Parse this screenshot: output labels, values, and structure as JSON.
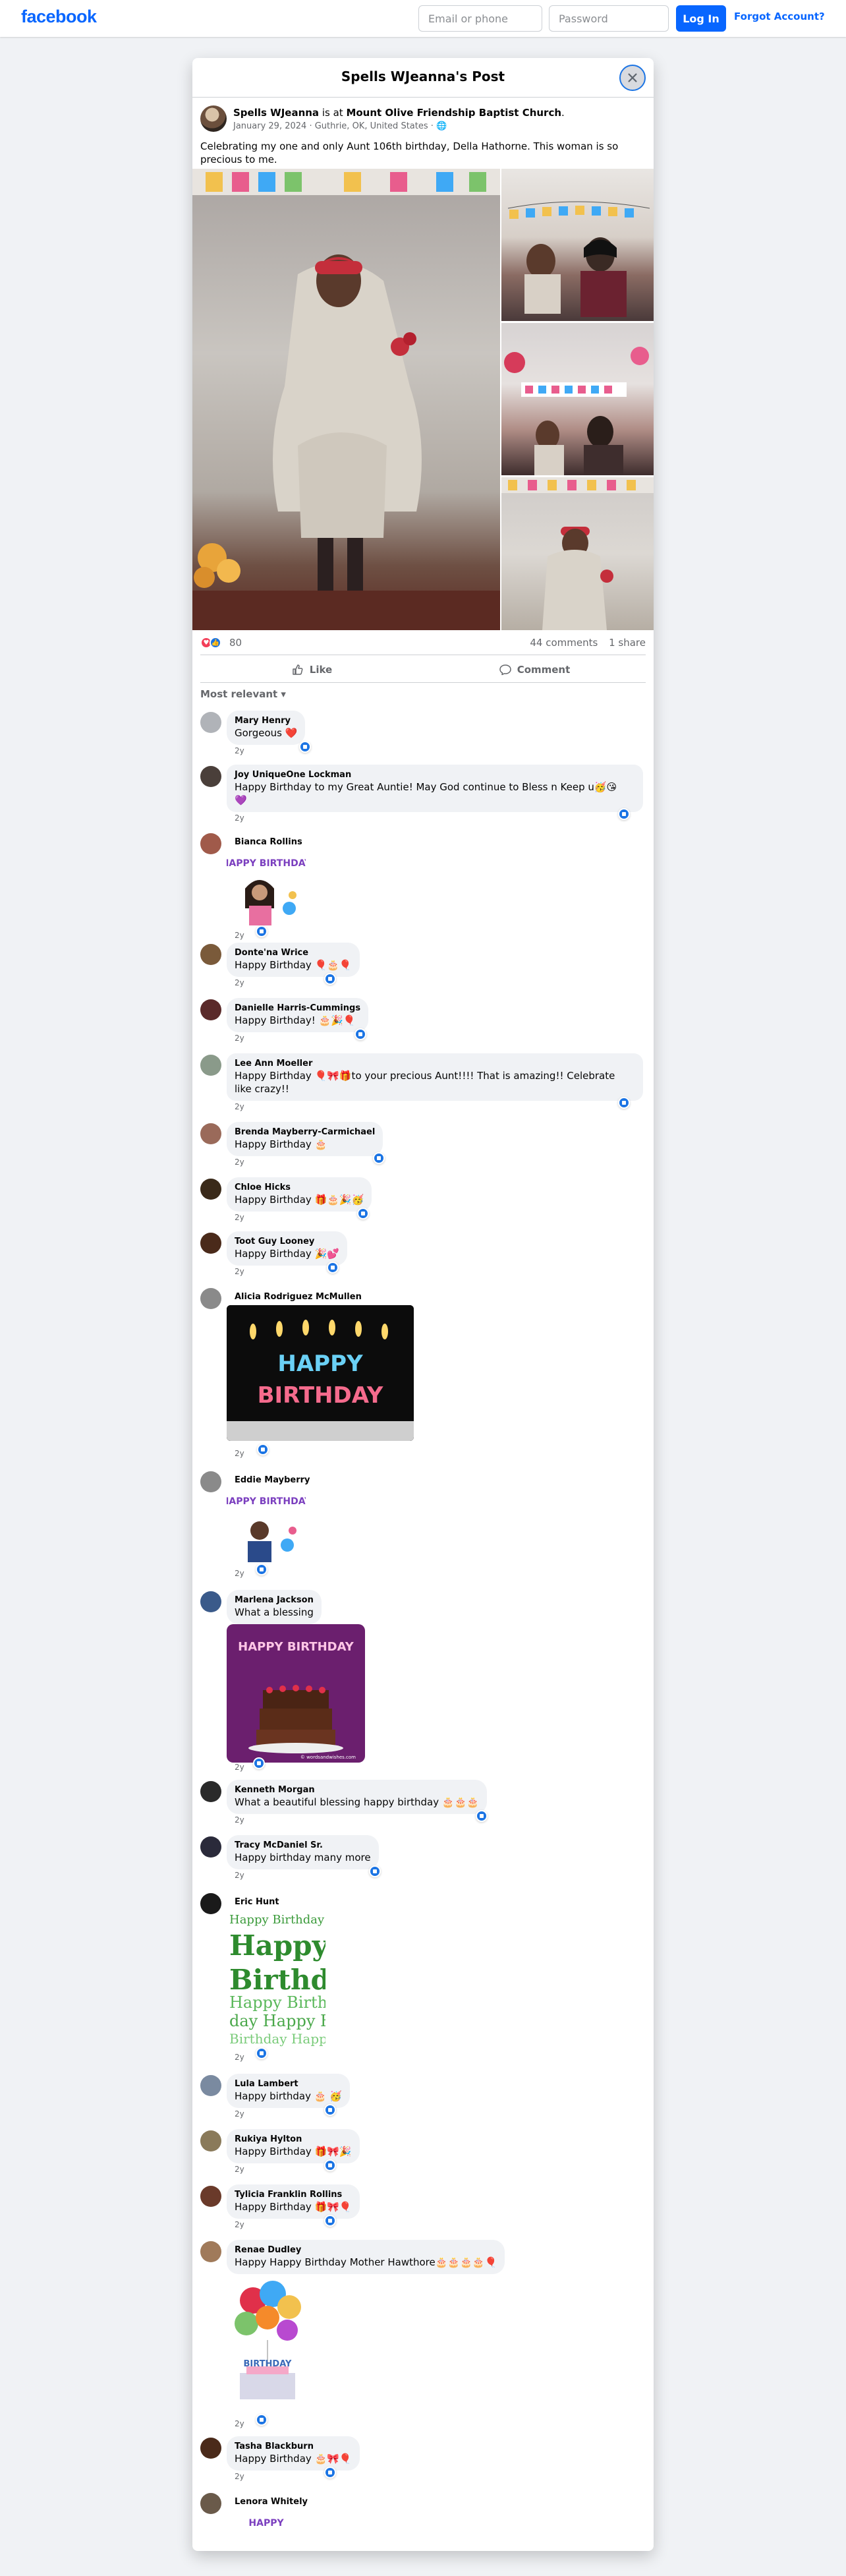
{
  "nav": {
    "logo": "facebook",
    "email_placeholder": "Email or phone",
    "password_placeholder": "Password",
    "login_label": "Log In",
    "forgot_label": "Forgot Account?"
  },
  "modal": {
    "title": "Spells WJeanna's Post",
    "close_icon": "close-icon"
  },
  "post": {
    "author": "Spells WJeanna",
    "is_at": "is at",
    "place": "Mount Olive Friendship Baptist Church",
    "date_location": "January 29, 2024 · Guthrie, OK, United States · ",
    "privacy_icon": "globe-icon",
    "text": "Celebrating my one and only Aunt 106th birthday, Della Hathorne. This woman is so precious to me.",
    "banner_text": "HAPPY BIRTHDAY",
    "reaction_count": "80",
    "comments_count": "44 comments",
    "shares_count": "1 share",
    "like_label": "Like",
    "comment_label": "Comment",
    "sort_label": "Most relevant"
  },
  "comments": [
    {
      "name": "Mary Henry",
      "text": "Gorgeous ❤️",
      "time": "2y"
    },
    {
      "name": "Joy UniqueOne Lockman",
      "text": "Happy Birthday to my Great Auntie! May God continue to Bless n Keep u🥳😘",
      "text2": "💜",
      "time": "2y"
    },
    {
      "name": "Bianca Rollins",
      "text": "",
      "time": "2y"
    },
    {
      "name": "Donte'na Wrice",
      "text": "Happy Birthday 🎈🎂🎈",
      "time": "2y"
    },
    {
      "name": "Danielle Harris-Cummings",
      "text": "Happy Birthday! 🎂🎉🎈",
      "time": "2y"
    },
    {
      "name": "Lee Ann Moeller",
      "text": "Happy Birthday 🎈🎀🎁to your precious Aunt!!!! That is amazing!! Celebrate",
      "text2": "like crazy!!",
      "time": "2y"
    },
    {
      "name": "Brenda Mayberry-Carmichael",
      "text": "Happy Birthday 🎂",
      "time": "2y"
    },
    {
      "name": "Chloe Hicks",
      "text": "Happy Birthday 🎁🎂🎉🥳",
      "time": "2y"
    },
    {
      "name": "Toot Guy Looney",
      "text": "Happy Birthday 🎉💕",
      "time": "2y"
    },
    {
      "name": "Alicia Rodriguez McMullen",
      "text": "",
      "time": "2y"
    },
    {
      "name": "Eddie Mayberry",
      "text": "",
      "time": "2y"
    },
    {
      "name": "Marlena Jackson",
      "text": "What a blessing",
      "time": "2y"
    },
    {
      "name": "Kenneth Morgan",
      "text": "What a beautiful blessing happy birthday 🎂🎂🎂",
      "time": "2y"
    },
    {
      "name": "Tracy McDaniel Sr.",
      "text": "Happy birthday many more",
      "time": "2y"
    },
    {
      "name": "Eric Hunt",
      "text": "",
      "time": "2y"
    },
    {
      "name": "Lula Lambert",
      "text": "Happy birthday 🎂 🥳",
      "time": "2y"
    },
    {
      "name": "Rukiya Hylton",
      "text": "Happy Birthday 🎁🎀🎉",
      "time": "2y"
    },
    {
      "name": "Tylicia Franklin Rollins",
      "text": "Happy Birthday 🎁🎀🎈",
      "time": "2y"
    },
    {
      "name": "Renae Dudley",
      "text": "Happy Happy Birthday Mother Hawthore🎂🎂🎂🎂🎈",
      "time": "2y"
    },
    {
      "name": "Tasha Blackburn",
      "text": "Happy Birthday 🎂🎀🎈",
      "time": "2y"
    },
    {
      "name": "Lenora Whitely",
      "text": "",
      "time": ""
    }
  ],
  "sticker_texts": {
    "happy_birthday_candles": "HAPPY BIRTHDAY",
    "cake_text": "HAPPY BIRTHDAY",
    "green_text": "Happy Birthday",
    "green_small": "Happy Birthday",
    "balloon_text": "BIRTHDAY",
    "bitmoji_text": "HAPPY BIRTHDAY",
    "watermark": "© wordsandwishes.com"
  },
  "colors": {
    "brand_blue": "#0866ff",
    "like_blue": "#1b74e4",
    "love_red": "#f33e58",
    "page_bg": "#f0f2f5"
  }
}
